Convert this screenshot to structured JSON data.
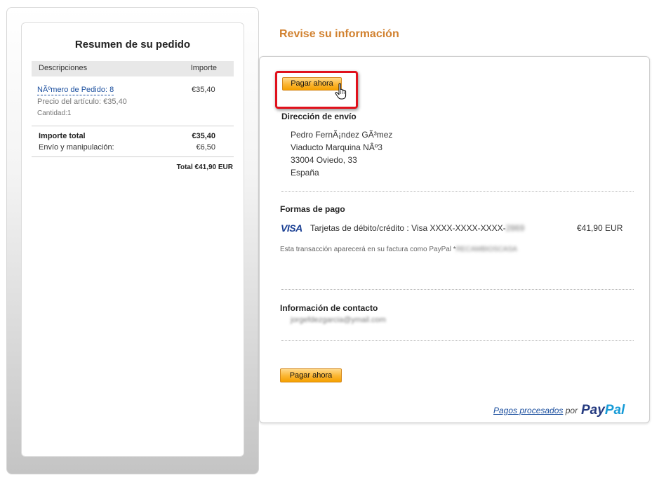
{
  "summary": {
    "title": "Resumen de su pedido",
    "col_description": "Descripciones",
    "col_amount": "Importe",
    "item": {
      "link_text": "NÃºmero de Pedido: 8",
      "amount": "€35,40",
      "unit_price": "Precio del artículo: €35,40",
      "quantity": "Cantidad:1"
    },
    "total_label": "Importe total",
    "total_value": "€35,40",
    "shipping_label": "Envío y manipulación:",
    "shipping_value": "€6,50",
    "grand_total": "Total €41,90 EUR"
  },
  "review": {
    "title": "Revise su información",
    "pay_button_top": "Pagar ahora",
    "pay_button_bottom": "Pagar ahora",
    "shipping": {
      "title": "Dirección de envío",
      "lines": [
        "Pedro FernÃ¡ndez GÃ³mez",
        "Viaducto Marquina NÂº3",
        "33004 Oviedo, 33",
        "España"
      ]
    },
    "payment": {
      "title": "Formas de pago",
      "card_brand": "VISA",
      "card_label": "Tarjetas de débito/crédito : Visa XXXX-XXXX-XXXX-",
      "card_last_digits": "2869",
      "amount": "€41,90 EUR",
      "statement_prefix": "Esta transacción aparecerá en su factura como PayPal *",
      "statement_name": "RECAMBIOSCASA"
    },
    "contact": {
      "title": "Información de contacto",
      "email": "jorgefdezgarcia@ymail.com"
    },
    "footer": {
      "processed_link": "Pagos procesados",
      "by": "por",
      "logo_pay": "Pay",
      "logo_pal": "Pal"
    }
  },
  "colors": {
    "accent_title": "#d1812f",
    "button": "#fbb531",
    "highlight": "#e0111c",
    "link": "#1a4e9e"
  },
  "icons": {
    "cursor": "hand-pointer-icon"
  }
}
